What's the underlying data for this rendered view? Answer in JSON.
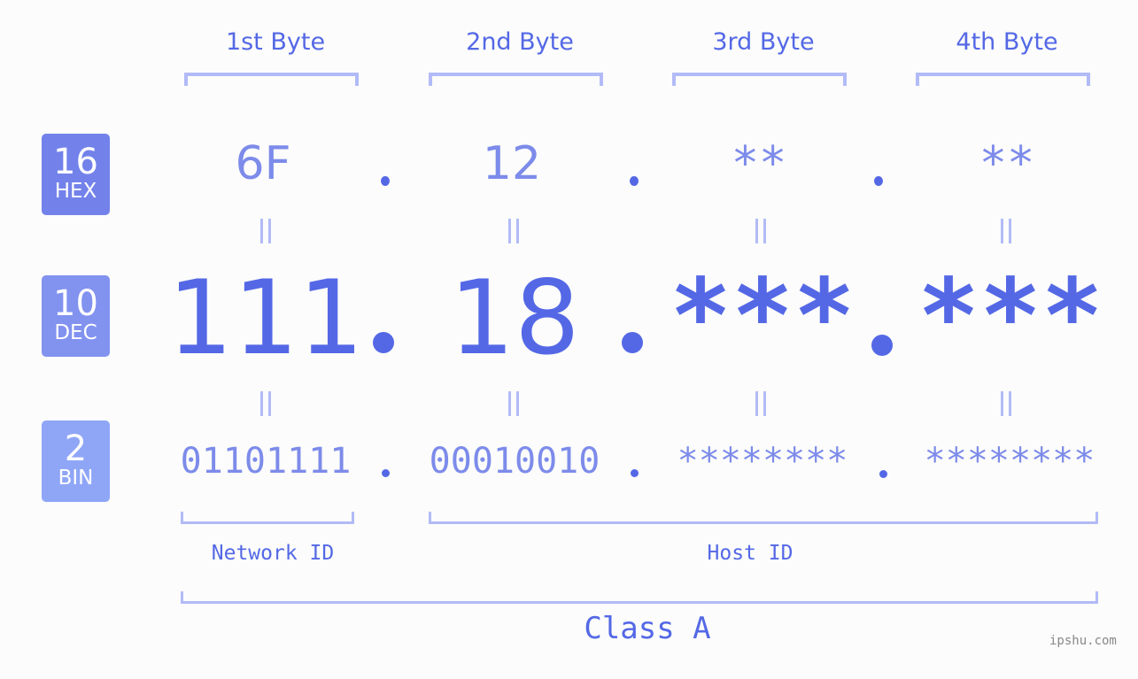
{
  "byte_headers": [
    "1st Byte",
    "2nd Byte",
    "3rd Byte",
    "4th Byte"
  ],
  "badges": {
    "hex": {
      "number": "16",
      "label": "HEX",
      "color": "#7382ea"
    },
    "dec": {
      "number": "10",
      "label": "DEC",
      "color": "#8292ef"
    },
    "bin": {
      "number": "2",
      "label": "BIN",
      "color": "#8fa6f7"
    }
  },
  "ip": {
    "hex": [
      "6F",
      "12",
      "**",
      "**"
    ],
    "dec": [
      "111",
      "18",
      "***",
      "***"
    ],
    "bin": [
      "01101111",
      "00010010",
      "********",
      "********"
    ]
  },
  "labels": {
    "network_id": "Network ID",
    "host_id": "Host ID",
    "class": "Class A"
  },
  "watermark": "ipshu.com",
  "colors": {
    "primary": "#5468e6",
    "secondary": "#7d8bea",
    "bracket": "#b2bbf7",
    "background": "#fbfcfb"
  }
}
